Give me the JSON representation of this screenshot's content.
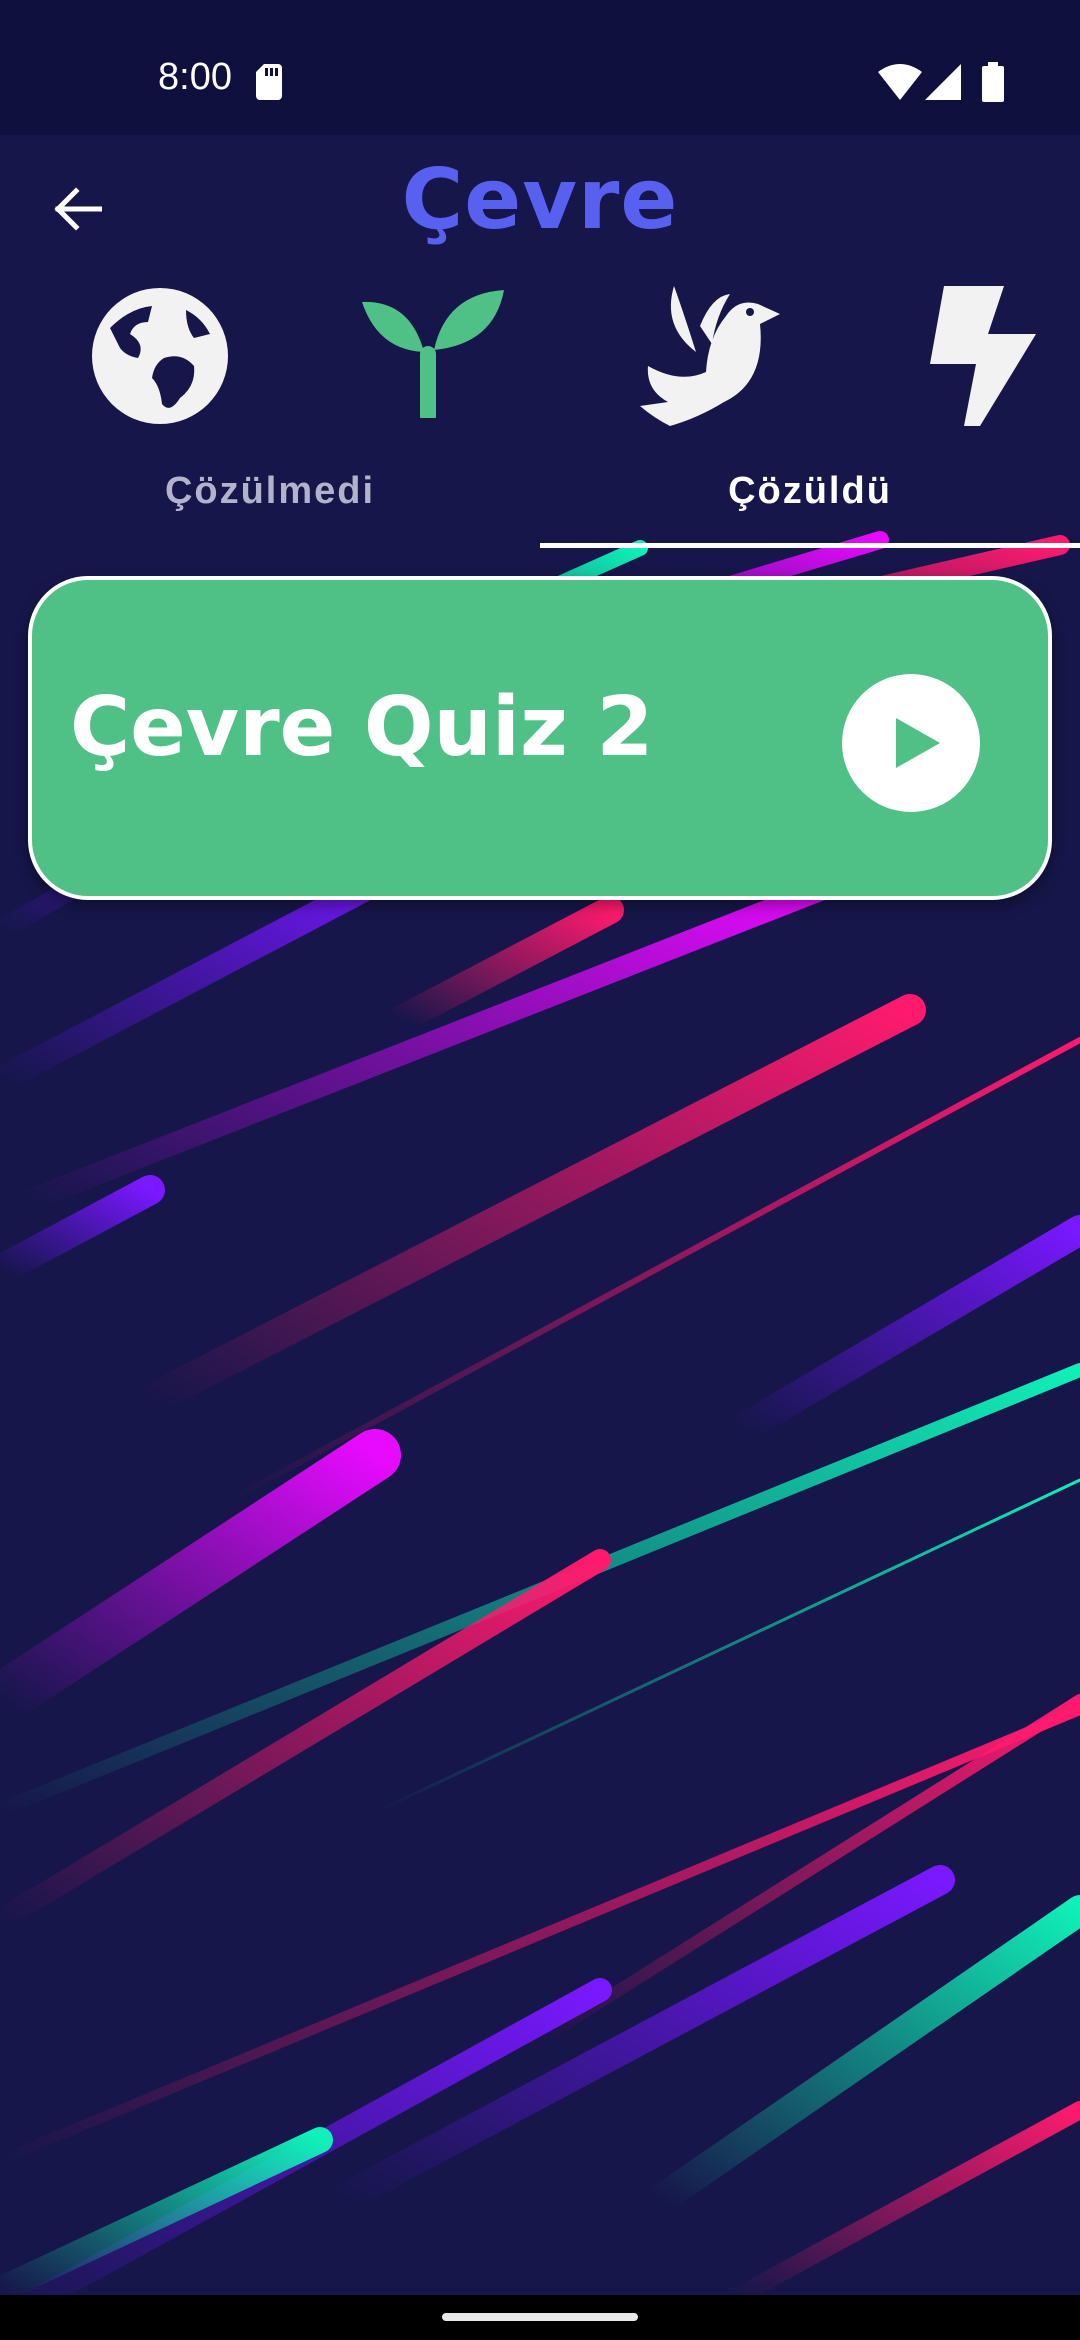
{
  "status_bar": {
    "time": "8:00",
    "icons": [
      "sd-card-icon",
      "wifi-icon",
      "signal-icon",
      "battery-icon"
    ]
  },
  "header": {
    "back_icon": "arrow-left-icon",
    "title": "Çevre"
  },
  "categories": [
    {
      "icon": "globe-icon",
      "color": "#f2f2f2"
    },
    {
      "icon": "sprout-icon",
      "color": "#4fc186"
    },
    {
      "icon": "dove-icon",
      "color": "#f2f2f2"
    },
    {
      "icon": "lightning-icon",
      "color": "#f2f2f2"
    }
  ],
  "tabs": [
    {
      "label": "Çözülmedi",
      "selected": false
    },
    {
      "label": "Çözüldü",
      "selected": true
    }
  ],
  "quizzes": [
    {
      "title": "Çevre Quiz 2",
      "action_icon": "play-icon"
    }
  ],
  "colors": {
    "background": "#16164a",
    "status_bar": "#10103f",
    "title_accent": "#5860f0",
    "card": "#4fc186",
    "stripe_colors": [
      "#ff1a6e",
      "#d10aff",
      "#7a18ff",
      "#10e8b0"
    ]
  }
}
